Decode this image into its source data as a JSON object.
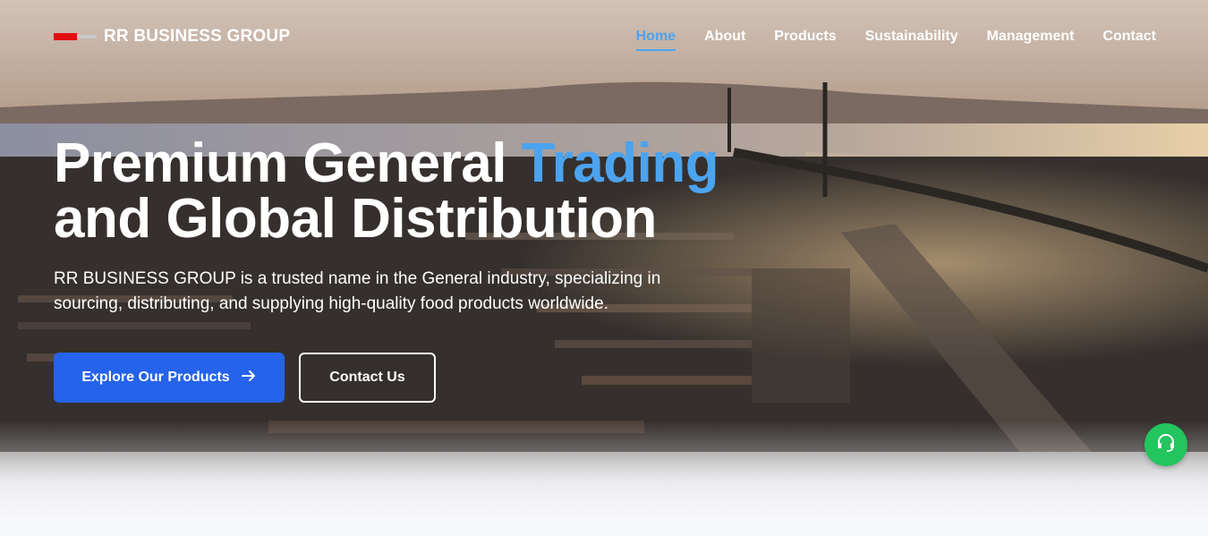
{
  "brand": {
    "name": "RR BUSINESS GROUP",
    "colors": {
      "red": "#e10f0f",
      "accent": "#4ca3ee",
      "primary": "#2563eb",
      "support": "#22c55e"
    }
  },
  "nav": {
    "items": [
      {
        "label": "Home",
        "active": true
      },
      {
        "label": "About"
      },
      {
        "label": "Products"
      },
      {
        "label": "Sustainability"
      },
      {
        "label": "Management"
      },
      {
        "label": "Contact"
      }
    ]
  },
  "hero": {
    "title_part1": "Premium General ",
    "title_accent": "Trading",
    "title_line2": "and Global Distribution",
    "description": "RR BUSINESS GROUP is a trusted name in the General industry, specializing in sourcing, distributing, and supplying high-quality food products worldwide.",
    "primary_button": "Explore Our Products",
    "secondary_button": "Contact Us",
    "background": "aerial view of container port at sunset"
  },
  "icons": {
    "arrow": "arrow-right-icon",
    "support": "headset-icon"
  }
}
